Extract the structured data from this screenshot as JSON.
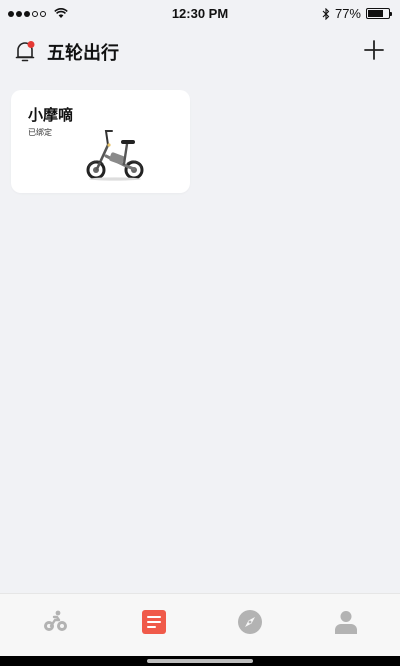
{
  "status_bar": {
    "time": "12:30 PM",
    "battery": "77%",
    "battery_level": 0.77,
    "signal_dots_filled": 3,
    "signal_dots_total": 5,
    "icons": [
      "signal-dots-icon",
      "wifi-icon",
      "bluetooth-icon",
      "battery-icon"
    ]
  },
  "header": {
    "title": "五轮出行",
    "left_icon": "bell-icon",
    "right_icon": "plus-icon",
    "accent_color": "#e53935"
  },
  "devices": [
    {
      "name": "小摩嘀",
      "status": "已绑定",
      "icon": "electric-bike-icon"
    }
  ],
  "tab_bar": {
    "items": [
      {
        "icon": "cycling-icon",
        "active": false
      },
      {
        "icon": "list-icon",
        "active": true
      },
      {
        "icon": "compass-icon",
        "active": false
      },
      {
        "icon": "person-icon",
        "active": false
      }
    ],
    "active_color": "#f05a4a",
    "inactive_color": "#b3b3b3"
  }
}
